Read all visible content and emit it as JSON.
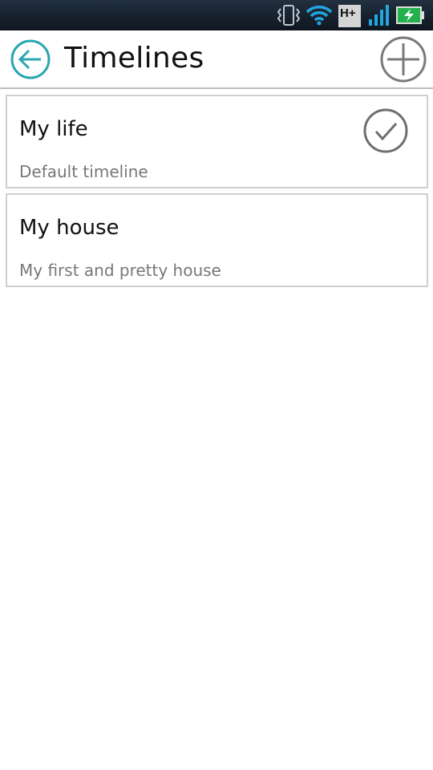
{
  "status_bar": {
    "network_type": "H+",
    "icons": [
      "vibrate-icon",
      "wifi-icon",
      "network-type-icon",
      "signal-icon",
      "battery-charging-icon"
    ]
  },
  "header": {
    "title": "Timelines",
    "back_icon": "back-arrow-icon",
    "add_icon": "plus-icon",
    "accent_color": "#2aa7b0"
  },
  "timelines": [
    {
      "name": "My life",
      "description": "Default timeline",
      "selected": true
    },
    {
      "name": "My house",
      "description": "My first and pretty house",
      "selected": false
    }
  ]
}
